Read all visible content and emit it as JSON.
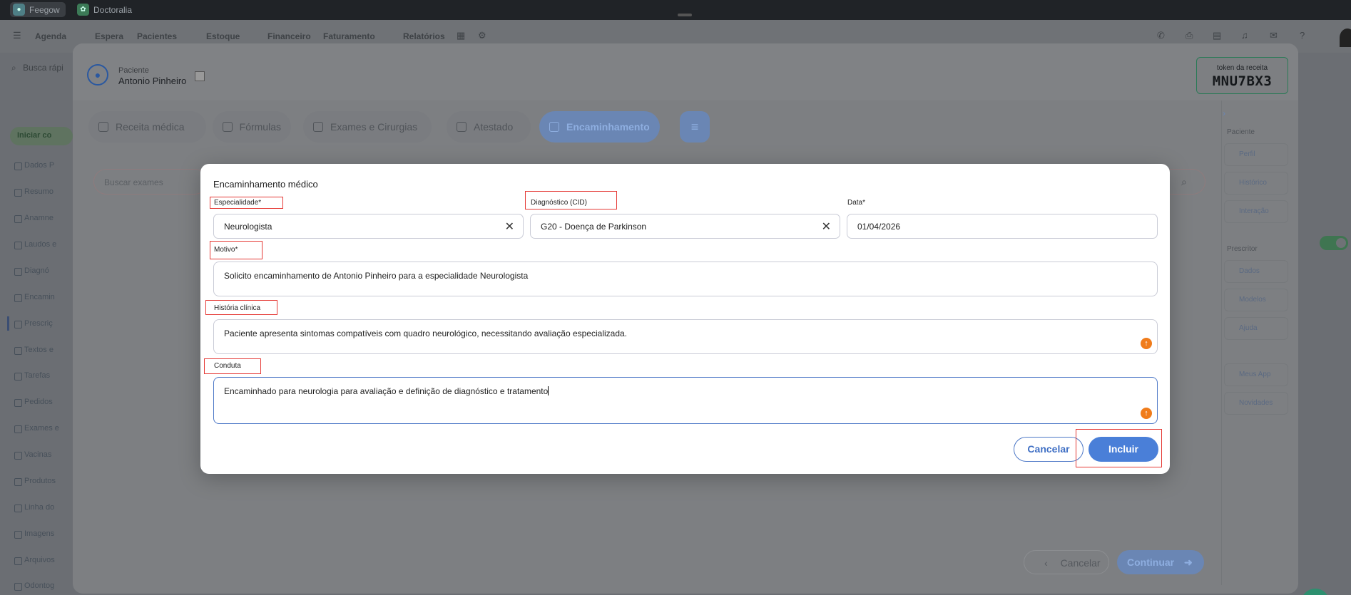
{
  "browser": {
    "tabs": [
      {
        "label": "Feegow"
      },
      {
        "label": "Doctoralia"
      }
    ]
  },
  "nav": {
    "items": [
      "Agenda",
      "Espera",
      "Pacientes",
      "Estoque",
      "Financeiro",
      "Faturamento",
      "Relatórios"
    ]
  },
  "background": {
    "search_placeholder": "Busca rápi",
    "start_button": "Iniciar co",
    "sidebar_items": [
      "Dados P",
      "Resumo",
      "Anamne",
      "Laudos e",
      "Diagnó",
      "Encamin",
      "Prescriç",
      "Textos e",
      "Tarefas",
      "Pedidos",
      "Exames e",
      "Vacinas",
      "Produtos",
      "Linha do",
      "Imagens",
      "Arquivos",
      "Odontog"
    ]
  },
  "modal": {
    "patient_label": "Paciente",
    "patient_name": "Antonio Pinheiro",
    "token_label": "token da receita",
    "token_value": "MNU7BX3",
    "tabs": [
      "Receita médica",
      "Fórmulas",
      "Exames e Cirurgias",
      "Atestado",
      "Encaminhamento"
    ],
    "active_tab": "Encaminhamento",
    "search_placeholder": "Buscar exames",
    "right_panel": {
      "section_paciente": "Paciente",
      "paciente_items": [
        "Perfil",
        "Histórico",
        "Interação"
      ],
      "section_prescritor": "Prescritor",
      "prescritor_items": [
        "Dados",
        "Modelos",
        "Ajuda"
      ],
      "extra_items": [
        "Meus App",
        "Novidades"
      ]
    },
    "footer": {
      "cancel": "Cancelar",
      "continue": "Continuar"
    }
  },
  "dialog": {
    "title": "Encaminhamento médico",
    "fields": {
      "especialidade": {
        "label": "Especialidade*",
        "value": "Neurologista"
      },
      "diagnostico": {
        "label": "Diagnóstico (CID)",
        "value": "G20 - Doença de Parkinson"
      },
      "data": {
        "label": "Data*",
        "value": "01/04/2026"
      },
      "motivo": {
        "label": "Motivo*",
        "value": "Solicito encaminhamento de Antonio Pinheiro para a especialidade Neurologista"
      },
      "historia": {
        "label": "História clínica",
        "value": "Paciente apresenta sintomas compatíveis com quadro neurológico, necessitando avaliação especializada."
      },
      "conduta": {
        "label": "Conduta",
        "value": "Encaminhado para neurologia para avaliação e definição de diagnóstico e tratamento"
      }
    },
    "buttons": {
      "cancel": "Cancelar",
      "submit": "Incluir"
    }
  },
  "colors": {
    "primary": "#4a7fd8",
    "highlight": "#e53935",
    "ai_accent": "#f07c1b",
    "token_border": "#2a7a56"
  }
}
